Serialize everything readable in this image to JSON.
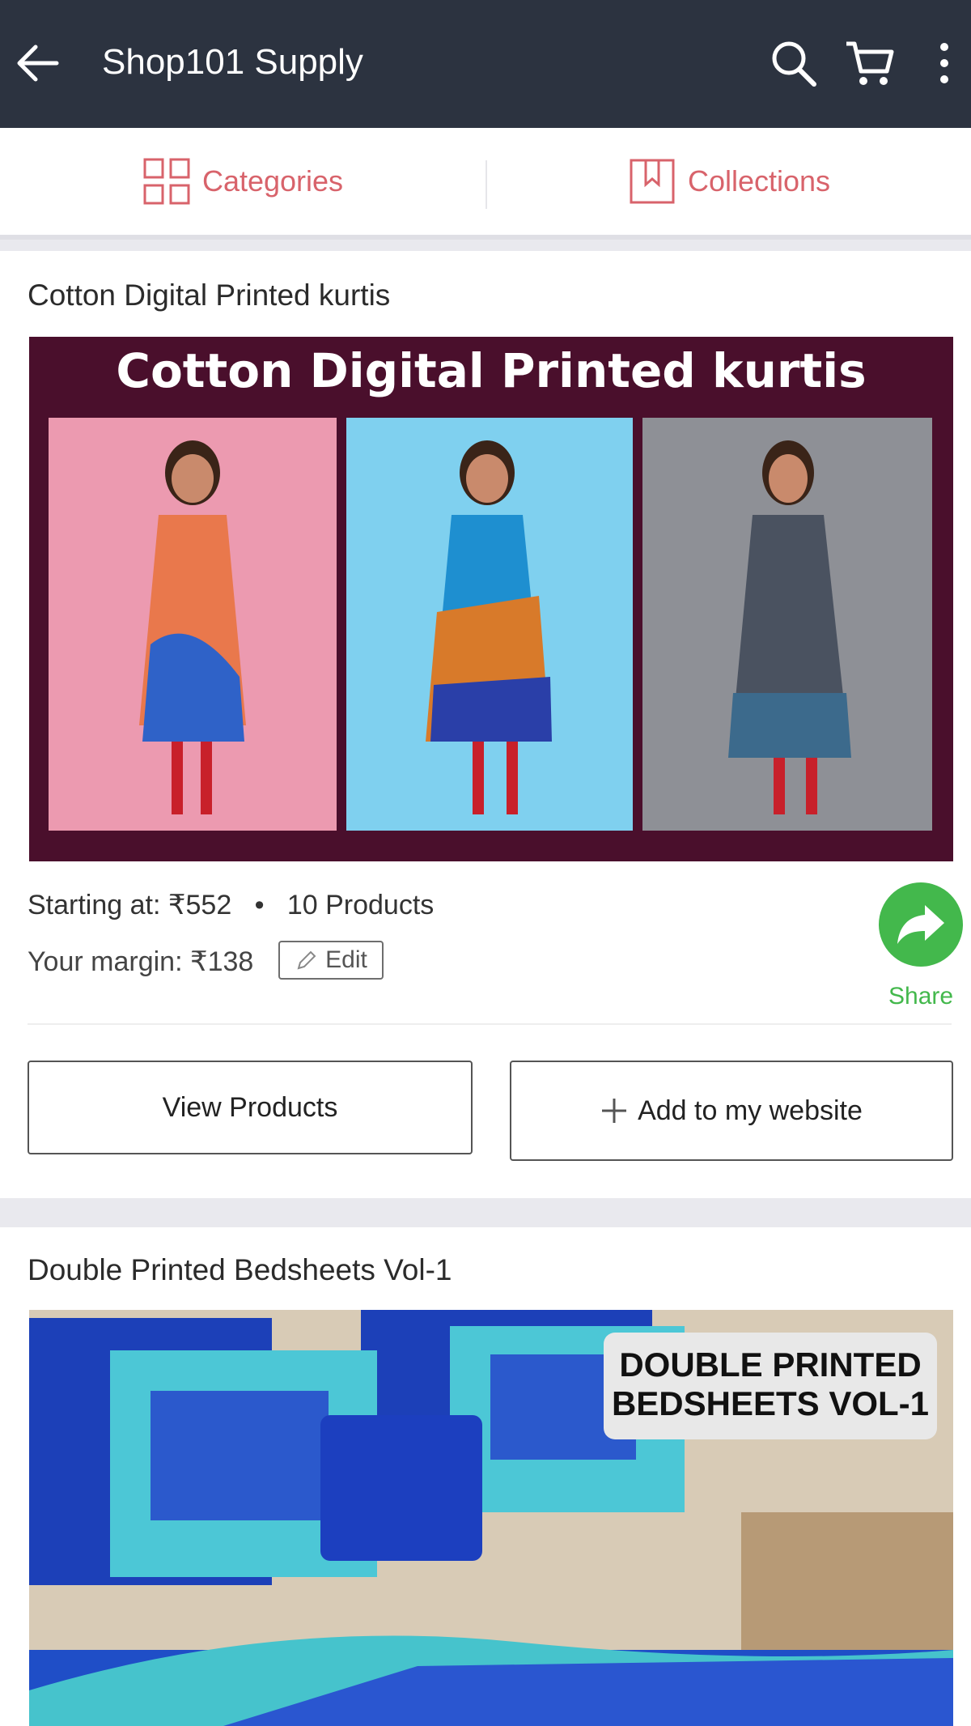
{
  "appbar": {
    "title": "Shop101 Supply",
    "icons": [
      "back-arrow-icon",
      "search-icon",
      "cart-icon",
      "more-vert-icon"
    ]
  },
  "tabs": [
    {
      "label": "Categories",
      "icon": "grid-icon"
    },
    {
      "label": "Collections",
      "icon": "bookmark-icon"
    }
  ],
  "collections": [
    {
      "title": "Cotton Digital Printed kurtis",
      "banner_text": "Cotton Digital Printed kurtis",
      "starting_at": "Starting at: ₹552",
      "products_count": "10 Products",
      "margin": "Your margin: ₹138",
      "edit_label": "Edit",
      "share_label": "Share",
      "view_label": "View Products",
      "add_label": "Add to my website"
    },
    {
      "title": "Double Printed Bedsheets Vol-1",
      "banner_line1": "DOUBLE PRINTED",
      "banner_line2": "BEDSHEETS VOL-1"
    }
  ],
  "colors": {
    "appbar": "#2c3340",
    "accent": "#d8636b",
    "share": "#43b84c",
    "banner_bg": "#4a0f2c"
  }
}
